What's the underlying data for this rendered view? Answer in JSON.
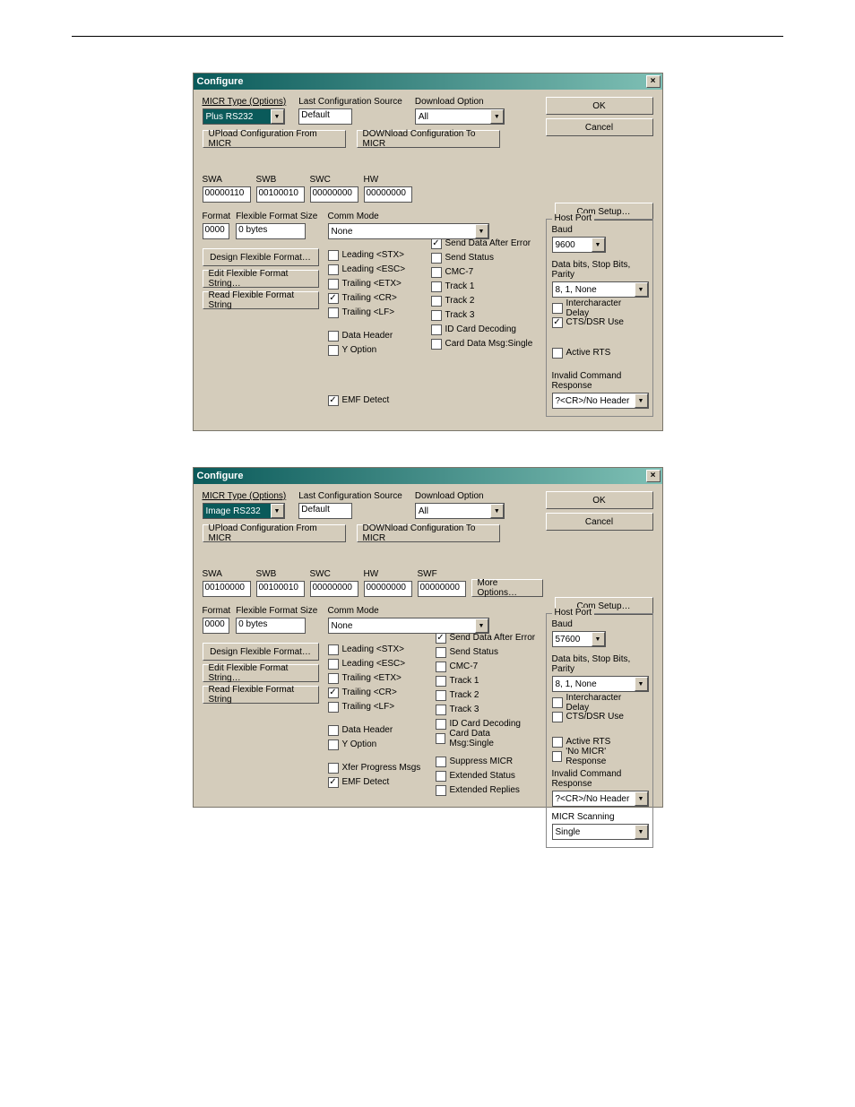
{
  "dialog1": {
    "title": "Configure",
    "top": {
      "micr_type_label": "MICR Type (Options)",
      "micr_type_value": "Plus RS232",
      "last_cfg_label": "Last Configuration Source",
      "last_cfg_value": "Default",
      "download_label": "Download Option",
      "download_value": "All",
      "upload_btn": "UPload Configuration From MICR",
      "download_btn": "DOWNload Configuration To MICR",
      "ok_btn": "OK",
      "cancel_btn": "Cancel"
    },
    "sw": {
      "swa_label": "SWA",
      "swa": "00000110",
      "swb_label": "SWB",
      "swb": "00100010",
      "swc_label": "SWC",
      "swc": "00000000",
      "hw_label": "HW",
      "hw": "00000000"
    },
    "format": {
      "fmt_label": "Format",
      "fmt": "0000",
      "ffs_label": "Flexible Format Size",
      "ffs": "0 bytes",
      "comm_label": "Comm Mode",
      "comm": "None"
    },
    "leftbtns": {
      "design": "Design Flexible Format…",
      "edit": "Edit Flexible Format String…",
      "read": "Read Flexible Format String"
    },
    "chkcol1": {
      "leading_stx": "Leading <STX>",
      "leading_esc": "Leading <ESC>",
      "trailing_etx": "Trailing <ETX>",
      "trailing_cr": "Trailing <CR>",
      "trailing_lf": "Trailing <LF>",
      "data_header": "Data Header",
      "y_option": "Y Option",
      "emf": "EMF Detect"
    },
    "chkcol2": {
      "send_after": "Send Data After Error",
      "send_status": "Send Status",
      "cmc7": "CMC-7",
      "track1": "Track 1",
      "track2": "Track 2",
      "track3": "Track 3",
      "idcard": "ID Card Decoding",
      "carddata": "Card Data Msg:Single"
    },
    "com_btn": "Com Setup…",
    "host": {
      "legend": "Host Port",
      "baud_label": "Baud",
      "baud": "9600",
      "dbsbp_label": "Data bits, Stop Bits, Parity",
      "dbsbp": "8, 1, None",
      "interchar": "Intercharacter Delay",
      "ctsdsr": "CTS/DSR Use",
      "activerts": "Active RTS",
      "icr_label": "Invalid Command Response",
      "icr": "?<CR>/No Header"
    }
  },
  "dialog2": {
    "title": "Configure",
    "top": {
      "micr_type_label": "MICR Type (Options)",
      "micr_type_value": "Image RS232",
      "last_cfg_label": "Last Configuration Source",
      "last_cfg_value": "Default",
      "download_label": "Download Option",
      "download_value": "All",
      "upload_btn": "UPload Configuration From MICR",
      "download_btn": "DOWNload Configuration To MICR",
      "ok_btn": "OK",
      "cancel_btn": "Cancel"
    },
    "sw": {
      "swa_label": "SWA",
      "swa": "00100000",
      "swb_label": "SWB",
      "swb": "00100010",
      "swc_label": "SWC",
      "swc": "00000000",
      "hw_label": "HW",
      "hw": "00000000",
      "swf_label": "SWF",
      "swf": "00000000",
      "more_btn": "More Options…"
    },
    "format": {
      "fmt_label": "Format",
      "fmt": "0000",
      "ffs_label": "Flexible Format Size",
      "ffs": "0 bytes",
      "comm_label": "Comm Mode",
      "comm": "None"
    },
    "leftbtns": {
      "design": "Design Flexible Format…",
      "edit": "Edit Flexible Format String…",
      "read": "Read Flexible Format String"
    },
    "chkcol1": {
      "leading_stx": "Leading <STX>",
      "leading_esc": "Leading <ESC>",
      "trailing_etx": "Trailing <ETX>",
      "trailing_cr": "Trailing <CR>",
      "trailing_lf": "Trailing <LF>",
      "data_header": "Data Header",
      "y_option": "Y Option",
      "xfer": "Xfer Progress Msgs",
      "emf": "EMF Detect"
    },
    "chkcol2": {
      "send_after": "Send Data After Error",
      "send_status": "Send Status",
      "cmc7": "CMC-7",
      "track1": "Track 1",
      "track2": "Track 2",
      "track3": "Track 3",
      "idcard": "ID Card Decoding",
      "carddata": "Card Data Msg:Single",
      "suppress": "Suppress MICR",
      "ext_status": "Extended Status",
      "ext_replies": "Extended Replies"
    },
    "com_btn": "Com Setup…",
    "host": {
      "legend": "Host Port",
      "baud_label": "Baud",
      "baud": "57600",
      "dbsbp_label": "Data bits, Stop Bits, Parity",
      "dbsbp": "8, 1, None",
      "interchar": "Intercharacter Delay",
      "ctsdsr": "CTS/DSR Use",
      "activerts": "Active RTS",
      "nomicr": "'No MICR' Response",
      "icr_label": "Invalid Command Response",
      "icr": "?<CR>/No Header",
      "scan_label": "MICR Scanning",
      "scan": "Single"
    }
  }
}
